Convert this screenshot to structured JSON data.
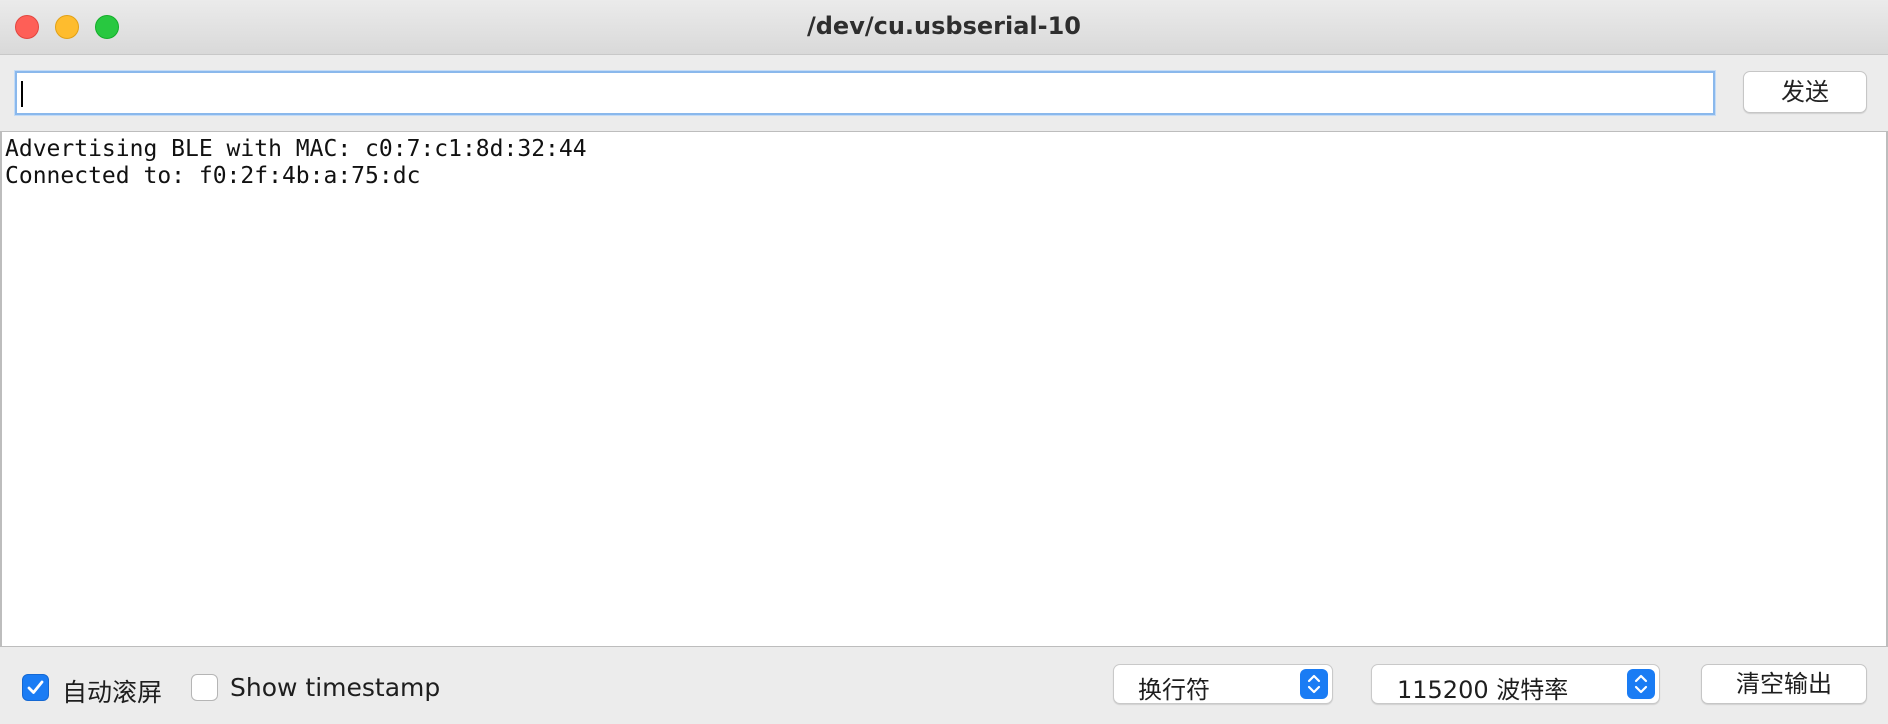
{
  "window": {
    "title": "/dev/cu.usbserial-10"
  },
  "send_bar": {
    "input_value": "",
    "send_label": "发送"
  },
  "output": {
    "lines": [
      "Advertising BLE with MAC: c0:7:c1:8d:32:44",
      "Connected to: f0:2f:4b:a:75:dc"
    ]
  },
  "footer": {
    "autoscroll": {
      "label": "自动滚屏",
      "checked": true
    },
    "timestamp": {
      "label": "Show timestamp",
      "checked": false
    },
    "line_ending": {
      "selected": "换行符"
    },
    "baud_rate": {
      "selected": "115200 波特率"
    },
    "clear_label": "清空输出"
  },
  "colors": {
    "accent": "#1a7cf4",
    "close": "#fe5f57",
    "minimize": "#febc2e",
    "maximize": "#28c840"
  },
  "icons": [
    "close-window-icon",
    "minimize-window-icon",
    "maximize-window-icon",
    "checkmark-icon",
    "select-arrows-icon"
  ]
}
